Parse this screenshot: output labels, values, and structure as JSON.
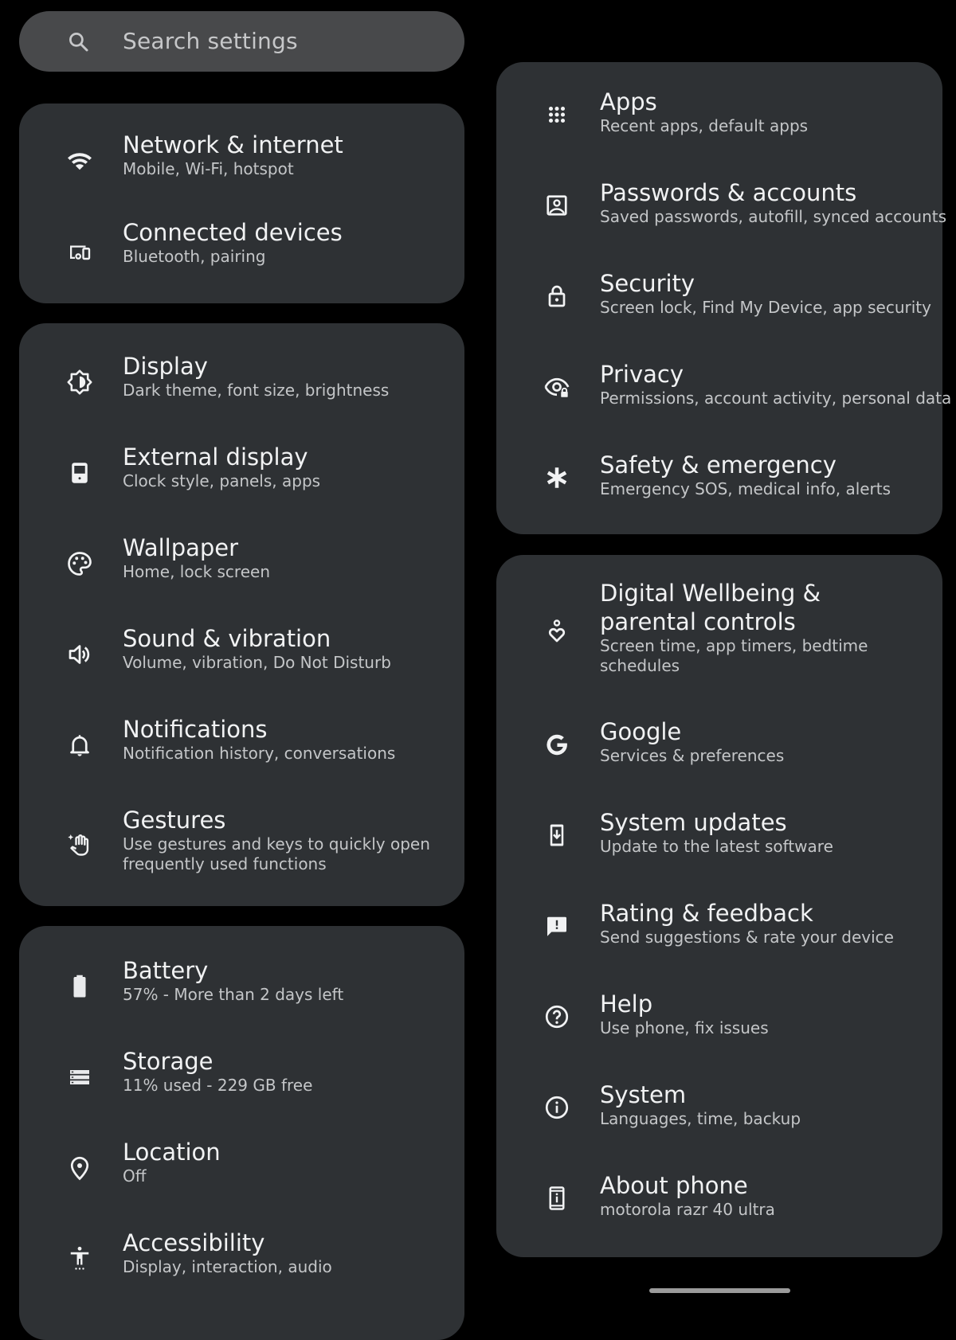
{
  "search": {
    "placeholder": "Search settings",
    "icon": "search-icon"
  },
  "left_column": {
    "cards": [
      {
        "items": [
          {
            "id": "network",
            "title": "Network & internet",
            "subtitle": "Mobile, Wi-Fi, hotspot",
            "icon": "wifi-icon"
          },
          {
            "id": "connected-devices",
            "title": "Connected devices",
            "subtitle": "Bluetooth, pairing",
            "icon": "connected-devices-icon"
          }
        ]
      },
      {
        "items": [
          {
            "id": "display",
            "title": "Display",
            "subtitle": "Dark theme, font size, brightness",
            "icon": "brightness-icon"
          },
          {
            "id": "external-display",
            "title": "External display",
            "subtitle": "Clock style, panels, apps",
            "icon": "external-display-icon"
          },
          {
            "id": "wallpaper",
            "title": "Wallpaper",
            "subtitle": "Home, lock screen",
            "icon": "palette-icon"
          },
          {
            "id": "sound",
            "title": "Sound & vibration",
            "subtitle": "Volume, vibration, Do Not Disturb",
            "icon": "volume-icon"
          },
          {
            "id": "notifications",
            "title": "Notifications",
            "subtitle": "Notification history, conversations",
            "icon": "bell-icon"
          },
          {
            "id": "gestures",
            "title": "Gestures",
            "subtitle": "Use gestures and keys to quickly open frequently used functions",
            "icon": "gesture-hand-icon"
          }
        ]
      },
      {
        "items": [
          {
            "id": "battery",
            "title": "Battery",
            "subtitle": "57% - More than 2 days left",
            "icon": "battery-icon"
          },
          {
            "id": "storage",
            "title": "Storage",
            "subtitle": "11% used - 229 GB free",
            "icon": "storage-icon"
          },
          {
            "id": "location",
            "title": "Location",
            "subtitle": "Off",
            "icon": "location-pin-icon"
          },
          {
            "id": "accessibility",
            "title": "Accessibility",
            "subtitle": "Display, interaction, audio",
            "icon": "accessibility-icon"
          }
        ]
      }
    ]
  },
  "right_column": {
    "cards": [
      {
        "items": [
          {
            "id": "apps",
            "title": "Apps",
            "subtitle": "Recent apps, default apps",
            "icon": "apps-grid-icon"
          },
          {
            "id": "passwords",
            "title": "Passwords & accounts",
            "subtitle": "Saved passwords, autofill, synced accounts",
            "icon": "account-box-icon"
          },
          {
            "id": "security",
            "title": "Security",
            "subtitle": "Screen lock, Find My Device, app security",
            "icon": "lock-icon"
          },
          {
            "id": "privacy",
            "title": "Privacy",
            "subtitle": "Permissions, account activity, personal data",
            "icon": "privacy-eye-lock-icon"
          },
          {
            "id": "safety",
            "title": "Safety & emergency",
            "subtitle": "Emergency SOS, medical info, alerts",
            "icon": "asterisk-icon"
          }
        ]
      },
      {
        "items": [
          {
            "id": "wellbeing",
            "title": "Digital Wellbeing & parental controls",
            "subtitle": "Screen time, app timers, bedtime schedules",
            "icon": "wellbeing-heart-icon"
          },
          {
            "id": "google",
            "title": "Google",
            "subtitle": "Services & preferences",
            "icon": "google-g-icon"
          },
          {
            "id": "system-updates",
            "title": "System updates",
            "subtitle": "Update to the latest software",
            "icon": "system-update-icon"
          },
          {
            "id": "rating",
            "title": "Rating & feedback",
            "subtitle": "Send suggestions & rate your device",
            "icon": "feedback-icon"
          },
          {
            "id": "help",
            "title": "Help",
            "subtitle": "Use phone, fix issues",
            "icon": "help-circle-icon"
          },
          {
            "id": "system",
            "title": "System",
            "subtitle": "Languages, time, backup",
            "icon": "info-circle-icon"
          },
          {
            "id": "about",
            "title": "About phone",
            "subtitle": "motorola razr 40 ultra",
            "icon": "phone-info-icon"
          }
        ]
      }
    ]
  },
  "colors": {
    "background": "#000000",
    "card": "#2e3134",
    "search_bar": "#48494b",
    "title_text": "#f1f2f3",
    "subtitle_text": "#c4c6c8"
  }
}
